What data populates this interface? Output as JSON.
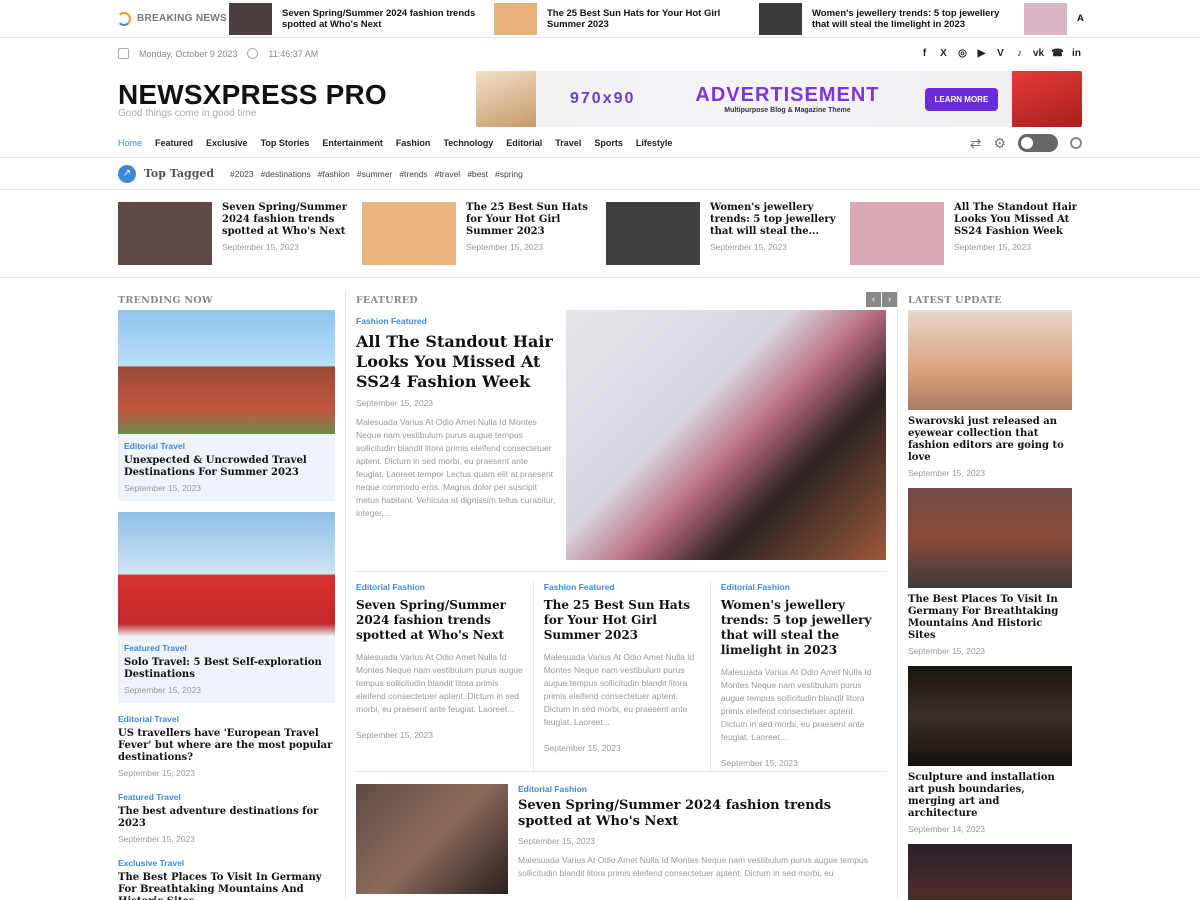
{
  "breaking": {
    "label": "BREAKING NEWS",
    "items": [
      {
        "title": "Seven Spring/Summer 2024 fashion trends spotted at Who's Next",
        "color": "#4a4040"
      },
      {
        "title": "The 25 Best Sun Hats for Your Hot Girl Summer 2023",
        "color": "#e8b27f"
      },
      {
        "title": "Women's jewellery trends: 5 top jewellery that will steal the limelight in 2023",
        "color": "#3a3a3a"
      },
      {
        "title": "A",
        "color": "#d8b6c6"
      }
    ]
  },
  "meta": {
    "date": "Monday, October 9 2023",
    "time": "11:46:37 AM",
    "social": [
      "f",
      "X",
      "◎",
      "▶",
      "V",
      "♪",
      "vk",
      "☎",
      "in"
    ]
  },
  "header": {
    "logo": "NEWSXPRESS PRO",
    "tagline": "Good things come in good time",
    "ad": {
      "size": "970x90",
      "title": "ADVERTISEMENT",
      "subtitle": "Multipurpose Blog & Magazine Theme",
      "button": "LEARN MORE"
    }
  },
  "nav": {
    "items": [
      "Home",
      "Featured",
      "Exclusive",
      "Top Stories",
      "Entertainment",
      "Fashion",
      "Technology",
      "Editorial",
      "Travel",
      "Sports",
      "Lifestyle"
    ]
  },
  "tagged": {
    "title": "Top Tagged",
    "tags": [
      "#2023",
      "#destinations",
      "#fashion",
      "#summer",
      "#trends",
      "#travel",
      "#best",
      "#spring"
    ]
  },
  "featured_row": [
    {
      "title": "Seven Spring/Summer 2024 fashion trends spotted at Who's Next",
      "date": "September 15, 2023",
      "color": "#5b4a45"
    },
    {
      "title": "The 25 Best Sun Hats for Your Hot Girl Summer 2023",
      "date": "September 15, 2023",
      "color": "#e9b47f"
    },
    {
      "title": "Women's jewellery trends: 5 top jewellery that will steal the...",
      "date": "September 15, 2023",
      "color": "#404040"
    },
    {
      "title": "All The Standout Hair Looks You Missed At SS24 Fashion Week",
      "date": "September 15, 2023",
      "color": "#d9a9b5"
    }
  ],
  "trending": {
    "title": "TRENDING NOW",
    "cards": [
      {
        "cat": "Editorial Travel",
        "title": "Unexpected & Uncrowded Travel Destinations For Summer 2023",
        "date": "September 15, 2023",
        "color": "#9a4a3b"
      },
      {
        "cat": "Featured Travel",
        "title": "Solo Travel: 5 Best Self-exploration Destinations",
        "date": "September 15, 2023",
        "color": "#d8322f"
      }
    ],
    "list": [
      {
        "cat": "Editorial Travel",
        "title": "US travellers have 'European Travel Fever' but where are the most popular destinations?",
        "date": "September 15, 2023"
      },
      {
        "cat": "Featured Travel",
        "title": "The best adventure destinations for 2023",
        "date": "September 15, 2023"
      },
      {
        "cat": "Exclusive Travel",
        "title": "The Best Places To Visit In Germany For Breathtaking Mountains And Historic Sites",
        "date": ""
      }
    ]
  },
  "featured": {
    "title": "FEATURED",
    "main": {
      "cat": "Fashion Featured",
      "title": "All The Standout Hair Looks You Missed At SS24 Fashion Week",
      "date": "September 15, 2023",
      "excerpt": "Malesuada Varius At Odio Amet Nulla Id Montes Neque nam vestibulum purus augue tempus sollicitudin blandit litora primis eleifend consectetuer aptent. Dictum in sed morbi, eu praesent ante feugiat. Laoreet tempor Lectus quam elit at praesent neque commodo eros. Magnis dolor per suscipit metus habitant. Vehicula at dignissim tellus curabitur, integer,...",
      "color": "#c9c7cf"
    },
    "minis": [
      {
        "cat": "Editorial Fashion",
        "title": "Seven Spring/Summer 2024 fashion trends spotted at Who's Next",
        "excerpt": "Malesuada Varius At Odio Amet Nulla Id Montes Neque nam vestibulum purus augue tempus sollicitudin blandit litora primis eleifend consectetuer aptent. Dictum in sed morbi, eu praesent ante feugiat. Laoreet...",
        "date": "September 15, 2023"
      },
      {
        "cat": "Fashion Featured",
        "title": "The 25 Best Sun Hats for Your Hot Girl Summer 2023",
        "excerpt": "Malesuada Varius At Odio Amet Nulla Id Montes Neque nam vestibulum purus augue tempus sollicitudin blandit litora primis eleifend consectetuer aptent. Dictum in sed morbi, eu praesent ante feugiat. Laoreet...",
        "date": "September 15, 2023"
      },
      {
        "cat": "Editorial Fashion",
        "title": "Women's jewellery trends: 5 top jewellery that will steal the limelight in 2023",
        "excerpt": "Malesuada Varius At Odio Amet Nulla Id Montes Neque nam vestibulum purus augue tempus sollicitudin blandit litora primis eleifend consectetuer aptent. Dictum in sed morbi, eu praesent ante feugiat. Laoreet...",
        "date": "September 15, 2023"
      }
    ],
    "bottom": {
      "cat": "Editorial Fashion",
      "title": "Seven Spring/Summer 2024 fashion trends spotted at Who's Next",
      "date": "September 15, 2023",
      "excerpt": "Malesuada Varius At Odio Amet Nulla Id Montes Neque nam vestibulum purus augue tempus sollicitudin blandit litora primis eleifend consectetuer aptent. Dictum in sed morbi, eu",
      "color": "#5d4a43"
    }
  },
  "latest": {
    "title": "LATEST UPDATE",
    "cards": [
      {
        "title": "Swarovski just released an eyewear collection that fashion editors are going to love",
        "date": "September 15, 2023",
        "color": "#d9a27d"
      },
      {
        "title": "The Best Places To Visit In Germany For Breathtaking Mountains And Historic Sites",
        "date": "September 15, 2023",
        "color": "#8a4a3a"
      },
      {
        "title": "Sculpture and installation art push boundaries, merging art and architecture",
        "date": "September 14, 2023",
        "color": "#3b2f28"
      },
      {
        "title": "",
        "date": "",
        "color": "#2a1f2a"
      }
    ]
  }
}
